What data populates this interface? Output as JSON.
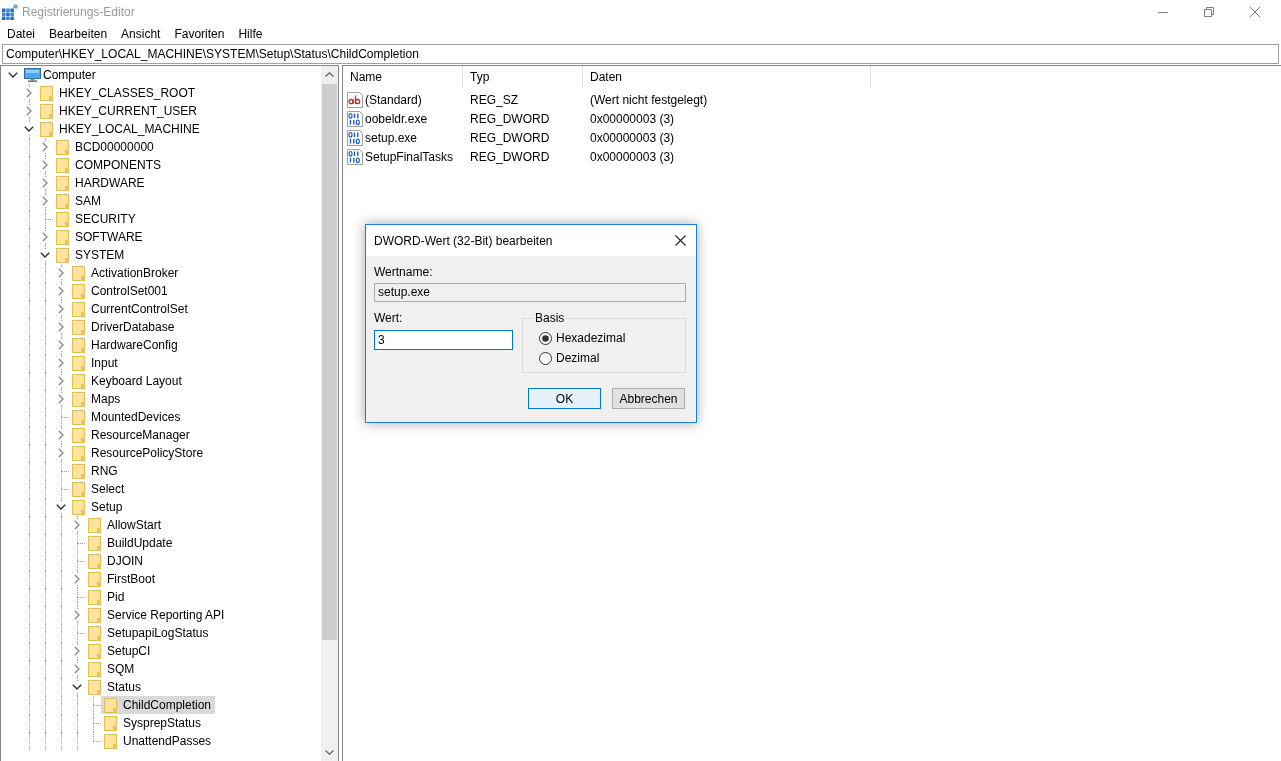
{
  "window": {
    "title": "Registrierungs-Editor",
    "active": false
  },
  "menu": [
    "Datei",
    "Bearbeiten",
    "Ansicht",
    "Favoriten",
    "Hilfe"
  ],
  "address_bar": {
    "value": "Computer\\HKEY_LOCAL_MACHINE\\SYSTEM\\Setup\\Status\\ChildCompletion"
  },
  "tree": [
    {
      "label": "Computer",
      "kind": "computer",
      "expandable": true,
      "expanded": true,
      "selected": false,
      "children": [
        {
          "label": "HKEY_CLASSES_ROOT",
          "kind": "folder",
          "expandable": true,
          "expanded": false,
          "selected": false
        },
        {
          "label": "HKEY_CURRENT_USER",
          "kind": "folder",
          "expandable": true,
          "expanded": false,
          "selected": false
        },
        {
          "label": "HKEY_LOCAL_MACHINE",
          "kind": "folder",
          "expandable": true,
          "expanded": true,
          "selected": false,
          "children": [
            {
              "label": "BCD00000000",
              "kind": "folder",
              "expandable": true,
              "expanded": false,
              "selected": false
            },
            {
              "label": "COMPONENTS",
              "kind": "folder",
              "expandable": true,
              "expanded": false,
              "selected": false
            },
            {
              "label": "HARDWARE",
              "kind": "folder",
              "expandable": true,
              "expanded": false,
              "selected": false
            },
            {
              "label": "SAM",
              "kind": "folder",
              "expandable": true,
              "expanded": false,
              "selected": false
            },
            {
              "label": "SECURITY",
              "kind": "folder",
              "expandable": false,
              "expanded": false,
              "selected": false
            },
            {
              "label": "SOFTWARE",
              "kind": "folder",
              "expandable": true,
              "expanded": false,
              "selected": false
            },
            {
              "label": "SYSTEM",
              "kind": "folder",
              "expandable": true,
              "expanded": true,
              "selected": false,
              "children": [
                {
                  "label": "ActivationBroker",
                  "kind": "folder",
                  "expandable": true,
                  "expanded": false,
                  "selected": false
                },
                {
                  "label": "ControlSet001",
                  "kind": "folder",
                  "expandable": true,
                  "expanded": false,
                  "selected": false
                },
                {
                  "label": "CurrentControlSet",
                  "kind": "folder",
                  "expandable": true,
                  "expanded": false,
                  "selected": false
                },
                {
                  "label": "DriverDatabase",
                  "kind": "folder",
                  "expandable": true,
                  "expanded": false,
                  "selected": false
                },
                {
                  "label": "HardwareConfig",
                  "kind": "folder",
                  "expandable": true,
                  "expanded": false,
                  "selected": false
                },
                {
                  "label": "Input",
                  "kind": "folder",
                  "expandable": true,
                  "expanded": false,
                  "selected": false
                },
                {
                  "label": "Keyboard Layout",
                  "kind": "folder",
                  "expandable": true,
                  "expanded": false,
                  "selected": false
                },
                {
                  "label": "Maps",
                  "kind": "folder",
                  "expandable": true,
                  "expanded": false,
                  "selected": false
                },
                {
                  "label": "MountedDevices",
                  "kind": "folder",
                  "expandable": false,
                  "expanded": false,
                  "selected": false
                },
                {
                  "label": "ResourceManager",
                  "kind": "folder",
                  "expandable": true,
                  "expanded": false,
                  "selected": false
                },
                {
                  "label": "ResourcePolicyStore",
                  "kind": "folder",
                  "expandable": true,
                  "expanded": false,
                  "selected": false
                },
                {
                  "label": "RNG",
                  "kind": "folder",
                  "expandable": false,
                  "expanded": false,
                  "selected": false
                },
                {
                  "label": "Select",
                  "kind": "folder",
                  "expandable": false,
                  "expanded": false,
                  "selected": false
                },
                {
                  "label": "Setup",
                  "kind": "folder",
                  "expandable": true,
                  "expanded": true,
                  "selected": false,
                  "children": [
                    {
                      "label": "AllowStart",
                      "kind": "folder",
                      "expandable": true,
                      "expanded": false,
                      "selected": false
                    },
                    {
                      "label": "BuildUpdate",
                      "kind": "folder",
                      "expandable": false,
                      "expanded": false,
                      "selected": false
                    },
                    {
                      "label": "DJOIN",
                      "kind": "folder",
                      "expandable": false,
                      "expanded": false,
                      "selected": false
                    },
                    {
                      "label": "FirstBoot",
                      "kind": "folder",
                      "expandable": true,
                      "expanded": false,
                      "selected": false
                    },
                    {
                      "label": "Pid",
                      "kind": "folder",
                      "expandable": false,
                      "expanded": false,
                      "selected": false
                    },
                    {
                      "label": "Service Reporting API",
                      "kind": "folder",
                      "expandable": true,
                      "expanded": false,
                      "selected": false
                    },
                    {
                      "label": "SetupapiLogStatus",
                      "kind": "folder",
                      "expandable": false,
                      "expanded": false,
                      "selected": false
                    },
                    {
                      "label": "SetupCI",
                      "kind": "folder",
                      "expandable": true,
                      "expanded": false,
                      "selected": false
                    },
                    {
                      "label": "SQM",
                      "kind": "folder",
                      "expandable": true,
                      "expanded": false,
                      "selected": false
                    },
                    {
                      "label": "Status",
                      "kind": "folder",
                      "expandable": true,
                      "expanded": true,
                      "selected": false,
                      "children": [
                        {
                          "label": "ChildCompletion",
                          "kind": "folder",
                          "expandable": false,
                          "expanded": false,
                          "selected": true
                        },
                        {
                          "label": "SysprepStatus",
                          "kind": "folder",
                          "expandable": false,
                          "expanded": false,
                          "selected": false
                        },
                        {
                          "label": "UnattendPasses",
                          "kind": "folder",
                          "expandable": false,
                          "expanded": false,
                          "selected": false
                        }
                      ]
                    }
                  ]
                }
              ]
            }
          ]
        }
      ]
    }
  ],
  "values_list": {
    "columns": [
      "Name",
      "Typ",
      "Daten"
    ],
    "rows": [
      {
        "kind": "string",
        "name": "(Standard)",
        "type": "REG_SZ",
        "data": "(Wert nicht festgelegt)",
        "selected": false
      },
      {
        "kind": "binary",
        "name": "oobeldr.exe",
        "type": "REG_DWORD",
        "data": "0x00000003 (3)",
        "selected": false
      },
      {
        "kind": "binary",
        "name": "setup.exe",
        "type": "REG_DWORD",
        "data": "0x00000003 (3)",
        "selected": false
      },
      {
        "kind": "binary",
        "name": "SetupFinalTasks",
        "type": "REG_DWORD",
        "data": "0x00000003 (3)",
        "selected": false
      }
    ]
  },
  "dialog": {
    "title": "DWORD-Wert (32-Bit) bearbeiten",
    "value_name": {
      "label": "Wertname:",
      "value": "setup.exe",
      "disabled": true
    },
    "value_data": {
      "label": "Wert:",
      "value": "3",
      "focused": true
    },
    "base": {
      "title": "Basis",
      "options": [
        {
          "label": "Hexadezimal",
          "selected": true
        },
        {
          "label": "Dezimal",
          "selected": false
        }
      ]
    },
    "buttons": [
      {
        "label": "OK",
        "default": true
      },
      {
        "label": "Abbrechen",
        "default": false
      }
    ]
  }
}
